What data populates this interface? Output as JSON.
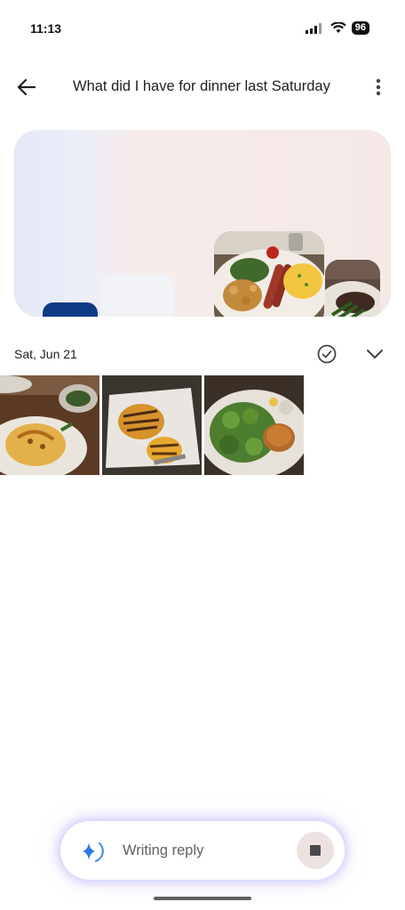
{
  "status_bar": {
    "time": "11:13",
    "battery": "96"
  },
  "header": {
    "title": "What did I have for dinner last Saturday",
    "back_icon": "arrow-left-icon",
    "more_icon": "more-vert-icon"
  },
  "results": {
    "date": "Sat, Jun 21",
    "photos": [
      "photo-omelette-plate",
      "photo-pastry-plate",
      "photo-salad-plate"
    ]
  },
  "reply_bar": {
    "status_text": "Writing reply",
    "stop_icon": "stop-icon",
    "accent": "#1a73e8"
  },
  "colors": {
    "background": "#ffffff",
    "text": "#1f1f1f",
    "muted": "#5f6368"
  }
}
